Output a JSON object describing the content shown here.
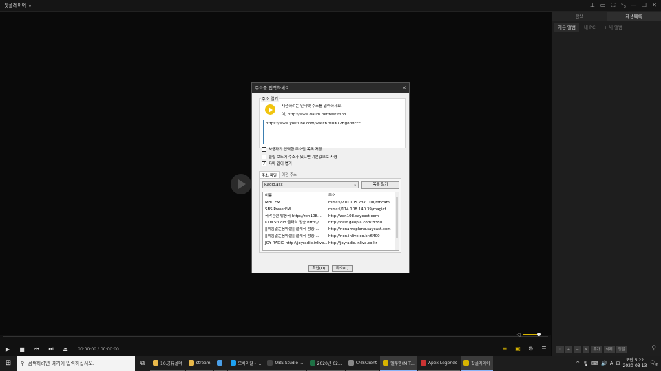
{
  "app": {
    "title": "팟플레이어",
    "title_chevron": "⌄"
  },
  "window_buttons": [
    "⊥",
    "▭",
    "⛶",
    "⤡",
    "—",
    "☐",
    "✕"
  ],
  "sidebar": {
    "tabs": [
      "탐색",
      "재생목록"
    ],
    "active_tab": "재생목록",
    "subtabs": [
      "기본 앨범",
      "내 PC",
      "+ 새 앨범"
    ],
    "bottom_buttons": [
      "↕",
      "+",
      "−",
      "×",
      "추가",
      "삭제",
      "정렬"
    ]
  },
  "controls": {
    "time_current": "00:00:00",
    "time_sep": "/",
    "time_total": "00:00:00",
    "volume_level": 0.85
  },
  "dialog": {
    "title": "주소를 입력하세요.",
    "close": "✕",
    "group_label": "주소 열기",
    "hint": "재생하려는 인터넷 주소를 입력하세요.",
    "example": "예) http://www.daum.net/test.mp3",
    "url_value": "https://www.youtube.com/watch?v=X72Hg8rMccc",
    "checkboxes": [
      {
        "label": "사용자가 입력한 주소만 목록 저장",
        "checked": false
      },
      {
        "label": "클립 보드에 주소가 있으면 기본값으로 사용",
        "checked": false
      },
      {
        "label": "자막 같이 열기",
        "checked": true
      }
    ],
    "tabs": [
      "주소 파일",
      "이전 주소"
    ],
    "select_value": "Radio.asx",
    "open_button": "목록 열기",
    "table": {
      "headers": [
        "이름",
        "주소"
      ],
      "rows": [
        [
          "MBC FM",
          "mms://210.105.237.100/mbcam"
        ],
        [
          "SBS PowerFM",
          "mms://114.108.140.39/magicf..."
        ],
        [
          "국악관현 방송국 http://zen108....",
          "http://zen108.saycast.com"
        ],
        [
          "KTM Studio 클래식 방송 http://...",
          "http://cast.geopia.com:8380"
        ],
        [
          "||이름없는음악실|| 클래식 방송 ...",
          "http://nonameplano.saycast.com"
        ],
        [
          "||이름없는음악실|| 클래식 방송 ...",
          "http://non.inlive.co.kr:6400"
        ],
        [
          "JOY RADIO http://joyradio.inlive...",
          "http://joyradio.inlive.co.kr"
        ]
      ]
    },
    "ok_button": "확인(O)",
    "cancel_button": "취소(C)"
  },
  "taskbar": {
    "search_placeholder": "검색하려면 여기에 입력하십시오.",
    "apps": [
      {
        "label": "10.공유폴더",
        "color": "#e8b84a"
      },
      {
        "label": "stream",
        "color": "#e8b84a"
      },
      {
        "label": "",
        "color": "#4a9fe8"
      },
      {
        "label": "모바이칼 - ...",
        "color": "#1da1f2"
      },
      {
        "label": "OBS Studio ...",
        "color": "#444444"
      },
      {
        "label": "2020년 02...",
        "color": "#1e7145"
      },
      {
        "label": "CMSClient",
        "color": "#888888"
      },
      {
        "label": "멜투명(M T...",
        "color": "#d8b400"
      },
      {
        "label": "Apex Legends",
        "color": "#cc3333"
      },
      {
        "label": "팟플레이어",
        "color": "#d8b400"
      }
    ],
    "tray_icons": [
      "^",
      "🎙",
      "⌨",
      "🔊",
      "A",
      "⊞"
    ],
    "time": "오전 5:22",
    "date": "2020-03-13",
    "notification_count": "6"
  }
}
